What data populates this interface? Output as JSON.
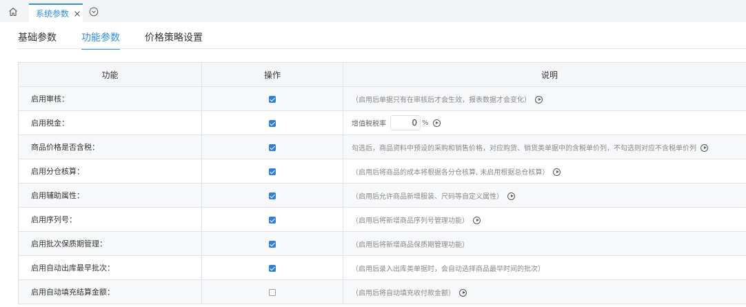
{
  "tabbar": {
    "active_tab_label": "系统参数"
  },
  "subtabs": [
    {
      "label": "基础参数",
      "active": false
    },
    {
      "label": "功能参数",
      "active": true
    },
    {
      "label": "价格策略设置",
      "active": false
    }
  ],
  "table": {
    "headers": [
      "功能",
      "操作",
      "说明"
    ],
    "rows": [
      {
        "func": "启用审核：",
        "checked": true,
        "desc": "（启用后单据只有在审核后才会生效，报表数据才会变化）",
        "has_play": true
      },
      {
        "func": "启用税金：",
        "checked": true,
        "rate_label": "增值税税率",
        "rate_value": "0",
        "rate_unit": "%",
        "has_play": true
      },
      {
        "func": "商品价格是否含税：",
        "checked": true,
        "desc": "勾选后，商品资料中预设的采购和销售价格，对应购货、销货类单据中的含税单价列，不勾选则对应不含税单价列",
        "has_play": true
      },
      {
        "func": "启用分仓核算：",
        "checked": true,
        "desc": "（启用后将商品的成本将根据各分仓核算, 未启用根据总仓核算）",
        "has_play": true
      },
      {
        "func": "启用辅助属性：",
        "checked": true,
        "desc": "（启用后允许商品新增服装、尺码等自定义属性）",
        "has_play": true
      },
      {
        "func": "启用序列号：",
        "checked": true,
        "desc": "（启用后将新增商品序列号管理功能）",
        "has_play": true
      },
      {
        "func": "启用批次保质期管理：",
        "checked": true,
        "desc": "（启用后将新增商品保质期管理功能）",
        "has_play": false
      },
      {
        "func": "启用自动出库最早批次：",
        "checked": true,
        "desc": "（启用后录入出库类单据时，会自动选择商品最早时间的批次）",
        "has_play": false
      },
      {
        "func": "启用自动填充结算金额：",
        "checked": false,
        "desc": "（启用后将自动填充收付款金额）",
        "has_play": true
      }
    ]
  },
  "colors": {
    "accent": "#2d8cf0",
    "checkbox": "#2d7ee0",
    "header_bg": "#f5f6f8",
    "alt_row_bg": "#f7f8fa",
    "border": "#dfe3e8"
  }
}
